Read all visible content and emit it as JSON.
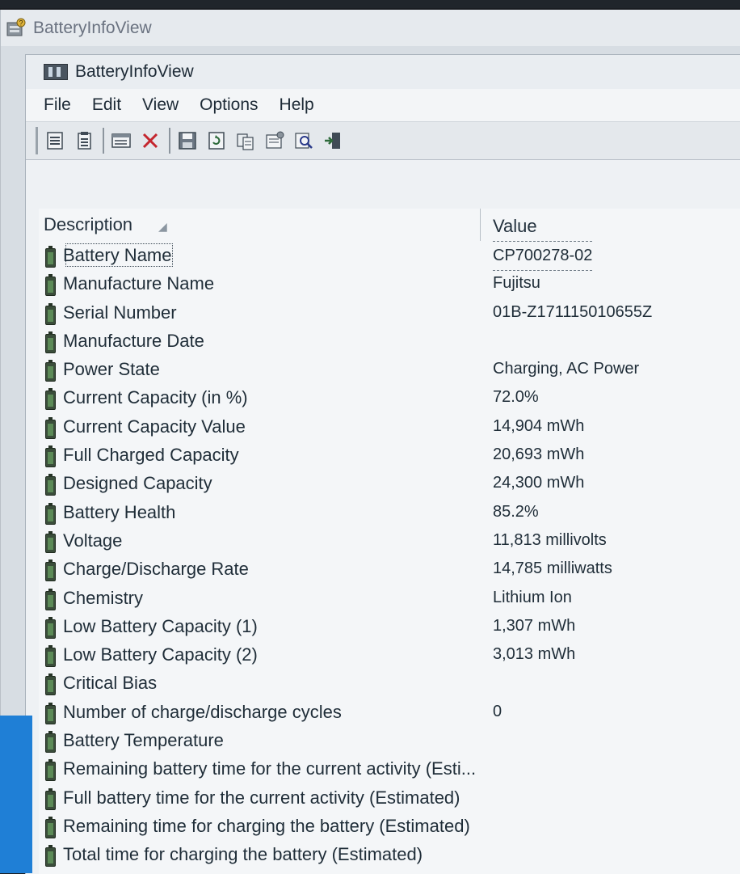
{
  "outer_window": {
    "title": "BatteryInfoView"
  },
  "window": {
    "title": "BatteryInfoView"
  },
  "menu": [
    "File",
    "Edit",
    "View",
    "Options",
    "Help"
  ],
  "toolbar": {
    "icons": [
      "properties-icon",
      "copy-list-icon",
      "html-report-icon",
      "delete-icon",
      "save-icon",
      "refresh-icon",
      "copy-icon",
      "options-icon",
      "find-icon",
      "exit-icon"
    ]
  },
  "table": {
    "columns": {
      "description": "Description",
      "value": "Value"
    },
    "rows": [
      {
        "description": "Battery Name",
        "value": "CP700278-02"
      },
      {
        "description": "Manufacture Name",
        "value": "Fujitsu"
      },
      {
        "description": "Serial Number",
        "value": "01B-Z171115010655Z"
      },
      {
        "description": "Manufacture Date",
        "value": ""
      },
      {
        "description": "Power State",
        "value": "Charging, AC Power"
      },
      {
        "description": "Current Capacity (in %)",
        "value": "72.0%"
      },
      {
        "description": "Current Capacity Value",
        "value": "14,904 mWh"
      },
      {
        "description": "Full Charged Capacity",
        "value": "20,693 mWh"
      },
      {
        "description": "Designed Capacity",
        "value": "24,300 mWh"
      },
      {
        "description": "Battery Health",
        "value": "85.2%"
      },
      {
        "description": "Voltage",
        "value": "11,813 millivolts"
      },
      {
        "description": "Charge/Discharge Rate",
        "value": "14,785 milliwatts"
      },
      {
        "description": "Chemistry",
        "value": "Lithium Ion"
      },
      {
        "description": "Low Battery Capacity (1)",
        "value": "1,307 mWh"
      },
      {
        "description": "Low Battery Capacity (2)",
        "value": "3,013 mWh"
      },
      {
        "description": "Critical Bias",
        "value": ""
      },
      {
        "description": "Number of charge/discharge cycles",
        "value": "0"
      },
      {
        "description": "Battery Temperature",
        "value": ""
      },
      {
        "description": "Remaining battery time for the current activity (Esti...",
        "value": ""
      },
      {
        "description": "Full battery time for the current activity (Estimated)",
        "value": ""
      },
      {
        "description": "Remaining time for charging the battery (Estimated)",
        "value": ""
      },
      {
        "description": "Total time for charging the battery (Estimated)",
        "value": ""
      }
    ]
  }
}
